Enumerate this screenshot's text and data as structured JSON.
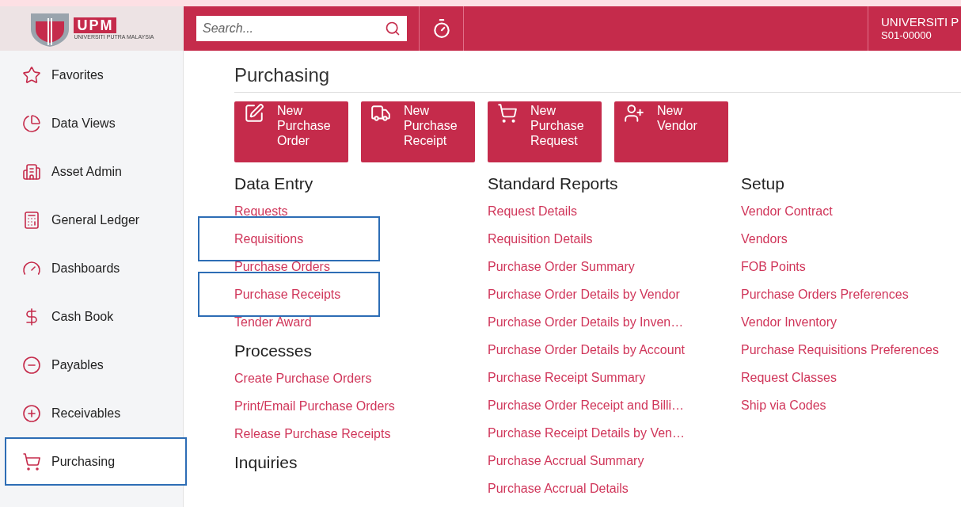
{
  "header": {
    "logo": {
      "mark": "UPM",
      "subtitle": "UNIVERSITI PUTRA MALAYSIA"
    },
    "search": {
      "placeholder": "Search..."
    },
    "account": {
      "name": "UNIVERSITI P",
      "code": "S01-00000"
    }
  },
  "sidebar": {
    "items": [
      {
        "label": "Favorites",
        "selected": false
      },
      {
        "label": "Data Views",
        "selected": false
      },
      {
        "label": "Asset Admin",
        "selected": false
      },
      {
        "label": "General Ledger",
        "selected": false
      },
      {
        "label": "Dashboards",
        "selected": false
      },
      {
        "label": "Cash Book",
        "selected": false
      },
      {
        "label": "Payables",
        "selected": false
      },
      {
        "label": "Receivables",
        "selected": false
      },
      {
        "label": "Purchasing",
        "selected": true
      }
    ]
  },
  "page": {
    "title": "Purchasing",
    "quick_actions": [
      {
        "label": "New Purchase Order"
      },
      {
        "label": "New Purchase Receipt"
      },
      {
        "label": "New Purchase Request"
      },
      {
        "label": "New Vendor"
      }
    ],
    "columns": [
      {
        "sections": [
          {
            "title": "Data Entry",
            "links": [
              {
                "label": "Requests",
                "highlighted": false
              },
              {
                "label": "Requisitions",
                "highlighted": true
              },
              {
                "label": "Purchase Orders",
                "highlighted": false
              },
              {
                "label": "Purchase Receipts",
                "highlighted": true
              },
              {
                "label": "Tender Award",
                "highlighted": false
              }
            ]
          },
          {
            "title": "Processes",
            "links": [
              {
                "label": "Create Purchase Orders",
                "highlighted": false
              },
              {
                "label": "Print/Email Purchase Orders",
                "highlighted": false
              },
              {
                "label": "Release Purchase Receipts",
                "highlighted": false
              }
            ]
          },
          {
            "title": "Inquiries"
          }
        ]
      },
      {
        "sections": [
          {
            "title": "Standard Reports",
            "links": [
              {
                "label": "Request Details",
                "highlighted": false
              },
              {
                "label": "Requisition Details",
                "highlighted": false
              },
              {
                "label": "Purchase Order Summary",
                "highlighted": false
              },
              {
                "label": "Purchase Order Details by Vendor",
                "highlighted": false
              },
              {
                "label": "Purchase Order Details by Inven…",
                "highlighted": false
              },
              {
                "label": "Purchase Order Details by Account",
                "highlighted": false
              },
              {
                "label": "Purchase Receipt Summary",
                "highlighted": false
              },
              {
                "label": "Purchase Order Receipt and Billi…",
                "highlighted": false
              },
              {
                "label": "Purchase Receipt Details by Ven…",
                "highlighted": false
              },
              {
                "label": "Purchase Accrual Summary",
                "highlighted": false
              },
              {
                "label": "Purchase Accrual Details",
                "highlighted": false
              }
            ]
          }
        ]
      },
      {
        "sections": [
          {
            "title": "Setup",
            "links": [
              {
                "label": "Vendor Contract",
                "highlighted": false
              },
              {
                "label": "Vendors",
                "highlighted": false
              },
              {
                "label": "FOB Points",
                "highlighted": false
              },
              {
                "label": "Purchase Orders Preferences",
                "highlighted": false
              },
              {
                "label": "Vendor Inventory",
                "highlighted": false
              },
              {
                "label": "Purchase Requisitions Preferences",
                "highlighted": false
              },
              {
                "label": "Request Classes",
                "highlighted": false
              },
              {
                "label": "Ship via Codes",
                "highlighted": false
              }
            ]
          }
        ]
      }
    ]
  }
}
